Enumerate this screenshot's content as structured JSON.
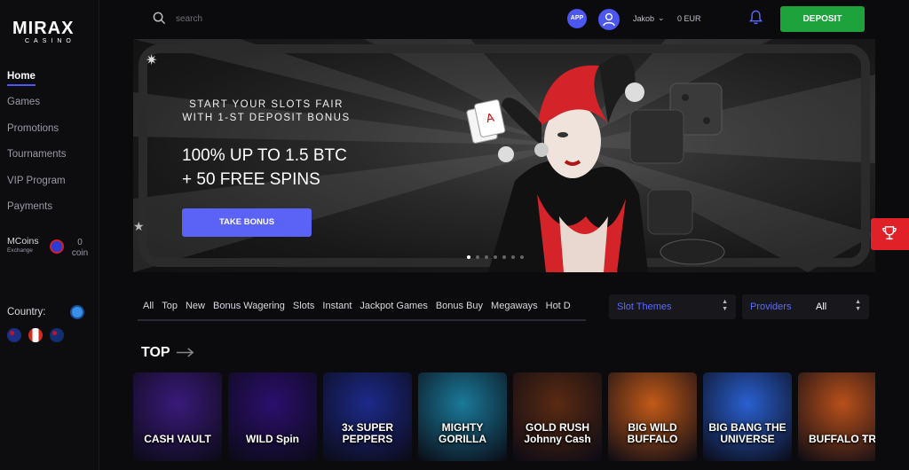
{
  "brand": {
    "name": "MIRAX",
    "sub": "CASINO"
  },
  "sidebar": {
    "items": [
      {
        "label": "Home"
      },
      {
        "label": "Games"
      },
      {
        "label": "Promotions"
      },
      {
        "label": "Tournaments"
      },
      {
        "label": "VIP Program"
      },
      {
        "label": "Payments"
      }
    ],
    "mcoins": {
      "title": "MCoins",
      "sub": "Exchange",
      "value": "0",
      "unit": "coin"
    },
    "country": {
      "label": "Country:"
    },
    "flags": [
      "australia-flag",
      "canada-flag",
      "new-zealand-flag"
    ]
  },
  "topbar": {
    "search_placeholder": "search",
    "app_badge": "APP",
    "username": "Jakob",
    "balance": "0 EUR",
    "deposit_label": "DEPOSIT"
  },
  "banner": {
    "subtitle_line1": "START YOUR SLOTS FAIR",
    "subtitle_line2": "WITH 1-ST DEPOSIT BONUS",
    "offer_line1": "100% UP TO 1.5 BTC",
    "offer_line2": "+ 50 FREE SPINS",
    "cta": "TAKE BONUS",
    "slides_count": 7,
    "active_slide": 0
  },
  "filters": {
    "tabs": [
      "All",
      "Top",
      "New",
      "Bonus Wagering",
      "Slots",
      "Instant",
      "Jackpot Games",
      "Bonus Buy",
      "Megaways",
      "Hot D"
    ],
    "slot_themes_label": "Slot Themes",
    "providers_label": "Providers",
    "providers_value": "All"
  },
  "section": {
    "title": "TOP"
  },
  "games": [
    {
      "title": "CASH VAULT",
      "color": "#3a1a7a"
    },
    {
      "title": "WILD Spin",
      "color": "#2b0f6e"
    },
    {
      "title": "3x SUPER PEPPERS",
      "color": "#1d2a8a"
    },
    {
      "title": "MIGHTY GORILLA",
      "color": "#1a7a9a"
    },
    {
      "title": "GOLD RUSH Johnny Cash",
      "color": "#5a2a12"
    },
    {
      "title": "BIG WILD BUFFALO",
      "color": "#c25a18"
    },
    {
      "title": "BIG BANG THE UNIVERSE",
      "color": "#2a60d0"
    },
    {
      "title": "BUFFALO TR",
      "color": "#b8501a"
    }
  ],
  "colors": {
    "accent": "#4b57f0",
    "deposit": "#1ea23c",
    "trophy": "#e02127"
  }
}
